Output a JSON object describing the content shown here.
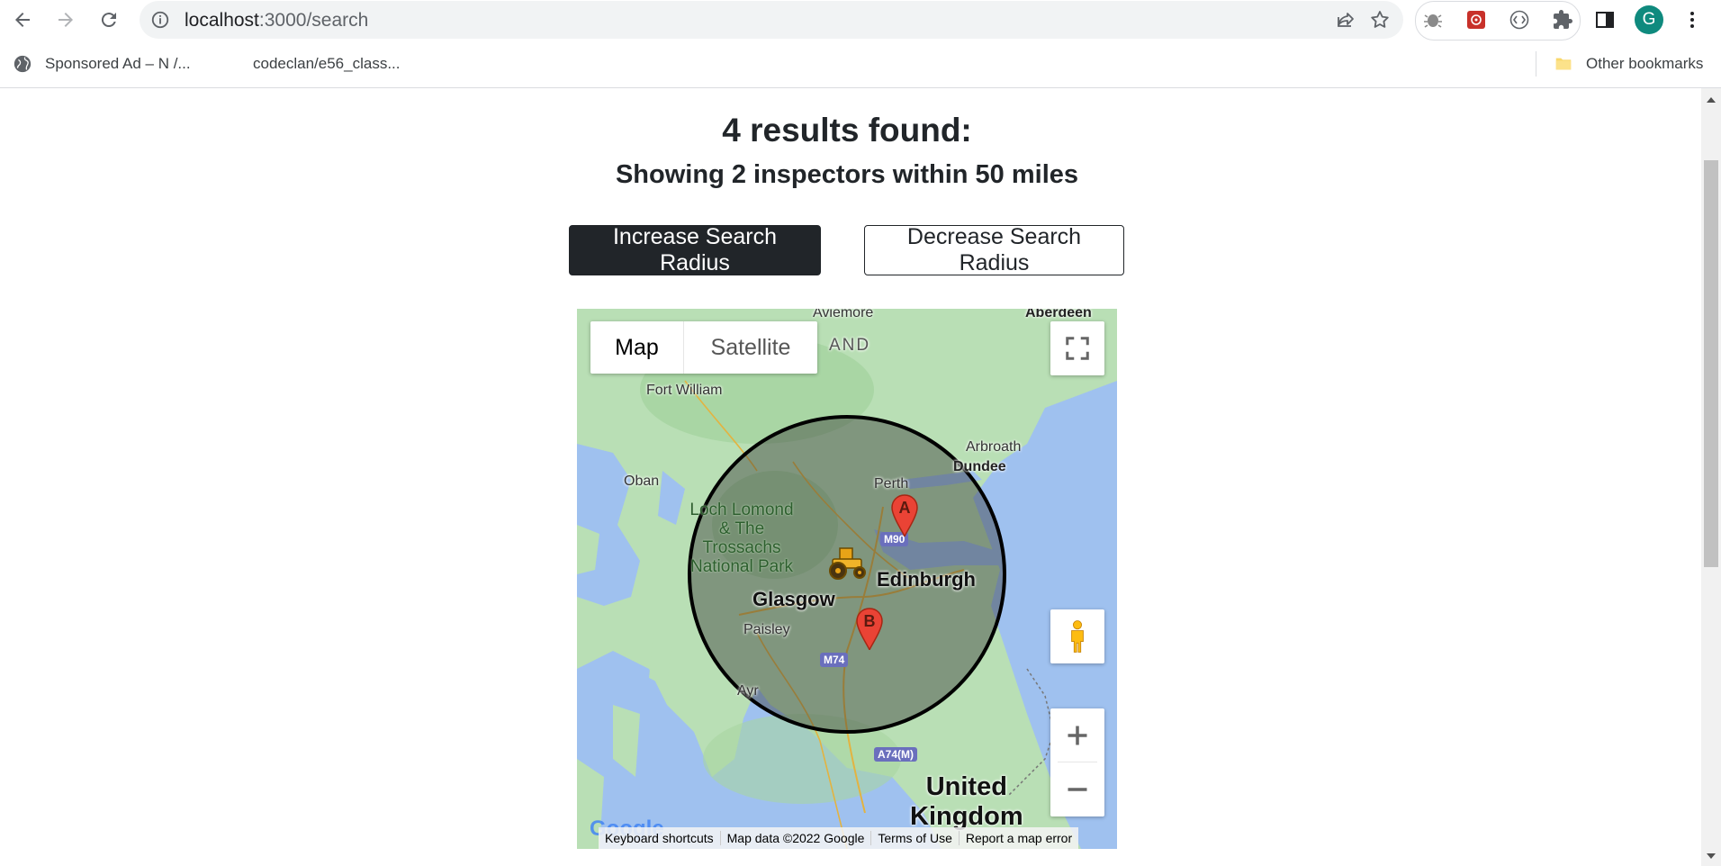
{
  "browser": {
    "url_host": "localhost",
    "url_path": ":3000/search",
    "profile_initial": "G",
    "bookmarks": [
      {
        "label": "Sponsored Ad – N /...",
        "icon": "globe-icon"
      },
      {
        "label": "codeclan/e56_class...",
        "icon": "none"
      }
    ],
    "other_bookmarks": "Other bookmarks"
  },
  "results": {
    "title": "4 results found:",
    "subtitle": "Showing 2 inspectors within 50 miles"
  },
  "buttons": {
    "increase": "Increase Search Radius",
    "decrease": "Decrease Search Radius"
  },
  "map": {
    "type_map": "Map",
    "type_satellite": "Satellite",
    "labels": {
      "aviemore": "Aviemore",
      "aberdeen": "Aberdeen",
      "scotland_fragment": "AND",
      "fort_william": "Fort William",
      "arbroath": "Arbroath",
      "dundee": "Dundee",
      "oban": "Oban",
      "perth": "Perth",
      "park": "Loch Lomond\n& The\nTrossachs\nNational Park",
      "edinburgh": "Edinburgh",
      "glasgow": "Glasgow",
      "paisley": "Paisley",
      "ayr": "Ayr",
      "country": "United\nKingdom",
      "m90": "M90",
      "m74": "M74",
      "a74m": "A74(M)",
      "google": "Google"
    },
    "markers": [
      {
        "label": "A",
        "color": "#ea4335"
      },
      {
        "label": "B",
        "color": "#ea4335"
      }
    ],
    "center_icon": "tractor-icon",
    "radius_circle_color": "#000000",
    "attribution": {
      "shortcuts": "Keyboard shortcuts",
      "data": "Map data ©2022 Google",
      "terms": "Terms of Use",
      "report": "Report a map error"
    }
  },
  "colors": {
    "primary_dark": "#212529",
    "water": "#9fc1ef",
    "land": "#b9dfb5",
    "avatar": "#0f8a7e"
  }
}
